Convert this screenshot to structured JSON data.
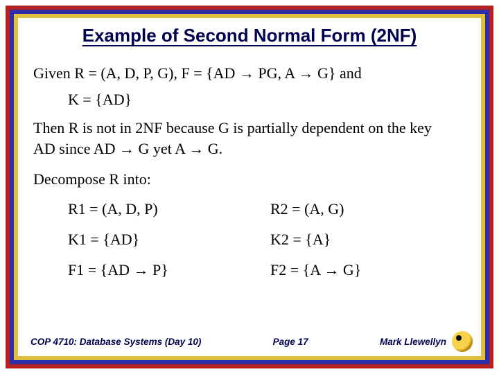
{
  "title": "Example of Second Normal Form (2NF)",
  "body": {
    "given": "Given R = (A, D, P, G), F = {AD → PG, A → G} and",
    "key": "K = {AD}",
    "then": "Then R is not in 2NF because G is partially dependent on the key AD since AD → G yet A → G.",
    "decompose_label": "Decompose R into:",
    "decomp": {
      "r1": "R1 = (A, D, P)",
      "r2": "R2 = (A, G)",
      "k1": "K1 = {AD}",
      "k2": "K2 = {A}",
      "f1": "F1 = {AD → P}",
      "f2": "F2 = {A → G}"
    }
  },
  "footer": {
    "course": "COP 4710: Database Systems (Day 10)",
    "page": "Page 17",
    "author": "Mark Llewellyn"
  }
}
